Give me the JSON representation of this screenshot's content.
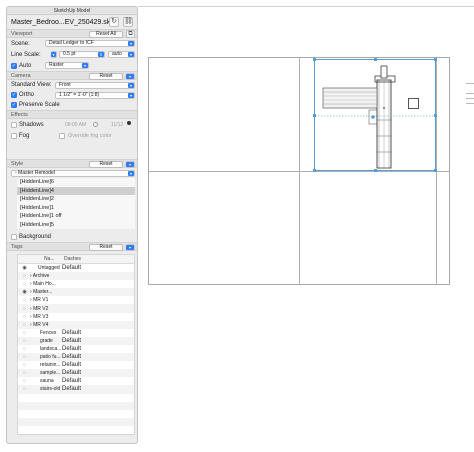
{
  "app_title": "SketchUp Model",
  "model": {
    "filename": "Master_Bedroo...EV_250429.skp"
  },
  "viewport": {
    "heading": "Viewport",
    "reset_all": "Reset All",
    "scene_label": "Scene:",
    "scene_value": "Detail Ledger to ICF",
    "line_scale_label": "Line Scale:",
    "line_scale_value": "0.5 pt",
    "line_scale_mode": "auto",
    "auto_label": "Auto",
    "render_mode": "Raster"
  },
  "camera": {
    "heading": "Camera",
    "reset": "Reset",
    "standard_view_label": "Standard View:",
    "standard_view_value": "Front",
    "ortho_label": "Ortho",
    "ortho_scale": "1 1/2\" = 1'-0\" (1:8)",
    "preserve_scale_label": "Preserve Scale"
  },
  "effects": {
    "heading": "Effects",
    "shadows_label": "Shadows",
    "shadow_time": "09:05 AM",
    "shadow_date": "11/12",
    "fog_label": "Fog",
    "override_fog_label": "Override fog color"
  },
  "style": {
    "heading": "Style",
    "reset": "Reset",
    "current": "Master Remodel",
    "items": [
      "[HiddenLine]6",
      "[HiddenLine]4",
      "[HiddenLine]2",
      "[HiddenLine]1",
      "[HiddenLine]1 off",
      "[HiddenLine]5"
    ],
    "background_label": "Background"
  },
  "tags": {
    "heading": "Tags",
    "reset": "Reset",
    "col_name": "Na...",
    "col_dashes": "Dashes",
    "rows": [
      {
        "name": "Untagged",
        "dash": "Default"
      },
      {
        "name": "Archive",
        "dash": ""
      },
      {
        "name": "Main Ho...",
        "dash": ""
      },
      {
        "name": "Master...",
        "dash": ""
      },
      {
        "name": "MR V1",
        "dash": ""
      },
      {
        "name": "MR V2",
        "dash": ""
      },
      {
        "name": "MR V3",
        "dash": ""
      },
      {
        "name": "MR V4",
        "dash": ""
      },
      {
        "name": "Fences",
        "dash": "Default"
      },
      {
        "name": "grade",
        "dash": "Default"
      },
      {
        "name": "landsca...",
        "dash": "Default"
      },
      {
        "name": "patio fu...",
        "dash": "Default"
      },
      {
        "name": "retainin...",
        "dash": "Default"
      },
      {
        "name": "sample...",
        "dash": "Default"
      },
      {
        "name": "sauna",
        "dash": "Default"
      },
      {
        "name": "stairs-old",
        "dash": "Default"
      }
    ]
  },
  "colors": {
    "accent": "#2f7cf6",
    "selection": "#5b9bd5",
    "panel": "#ececec"
  }
}
